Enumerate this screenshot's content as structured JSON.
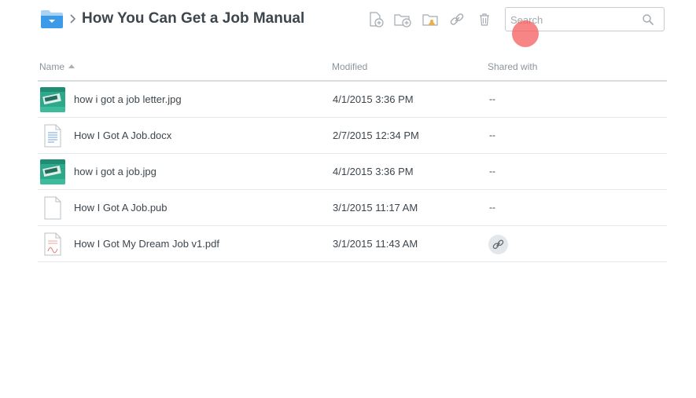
{
  "header": {
    "title": "How You Can Get a Job Manual",
    "toolbar": {
      "new_file": "new-file-icon",
      "new_folder": "new-folder-icon",
      "shared_folder": "shared-folder-icon",
      "share_link": "link-icon",
      "delete": "trash-icon"
    },
    "search": {
      "placeholder": "Search",
      "value": ""
    }
  },
  "columns": {
    "name": "Name",
    "modified": "Modified",
    "shared": "Shared with",
    "sort": "name-ascending"
  },
  "files": [
    {
      "name": "how i got a job letter.jpg",
      "modified": "4/1/2015 3:36 PM",
      "shared": "--",
      "icon": "image-thumbnail"
    },
    {
      "name": "How I Got A Job.docx",
      "modified": "2/7/2015 12:34 PM",
      "shared": "--",
      "icon": "document-icon"
    },
    {
      "name": "how i got a job.jpg",
      "modified": "4/1/2015 3:36 PM",
      "shared": "--",
      "icon": "image-thumbnail"
    },
    {
      "name": "How I Got A Job.pub",
      "modified": "3/1/2015 11:17 AM",
      "shared": "--",
      "icon": "blank-file-icon"
    },
    {
      "name": "How I Got My Dream Job v1.pdf",
      "modified": "3/1/2015 11:43 AM",
      "shared": "link-icon",
      "icon": "pdf-icon"
    }
  ],
  "colors": {
    "accent": "#3d9ae8",
    "text": "#3d464d",
    "muted": "#8b949c",
    "divider": "#e5e8ea",
    "thumbnail": "#2ea88a"
  }
}
